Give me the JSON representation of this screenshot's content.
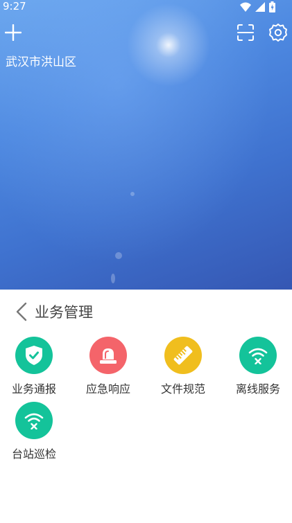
{
  "status_bar": {
    "time": "9:27",
    "icons": [
      "wifi-icon",
      "signal-icon",
      "battery-icon"
    ]
  },
  "top_bar": {
    "icons": [
      "plus-icon",
      "scan-icon",
      "settings-icon"
    ]
  },
  "location": "武汉市洪山区",
  "panel": {
    "title": "业务管理",
    "items": [
      {
        "label": "业务通报",
        "icon": "shield-check-icon",
        "color": "#14c39a"
      },
      {
        "label": "应急响应",
        "icon": "alarm-light-icon",
        "color": "#f4646a"
      },
      {
        "label": "文件规范",
        "icon": "ruler-icon",
        "color": "#f0be1e"
      },
      {
        "label": "离线服务",
        "icon": "wifi-off-icon",
        "color": "#14c39a"
      },
      {
        "label": "台站巡检",
        "icon": "wifi-off-icon",
        "color": "#14c39a"
      }
    ]
  },
  "colors": {
    "accent_green": "#14c39a",
    "accent_red": "#f4646a",
    "accent_yellow": "#f0be1e"
  }
}
